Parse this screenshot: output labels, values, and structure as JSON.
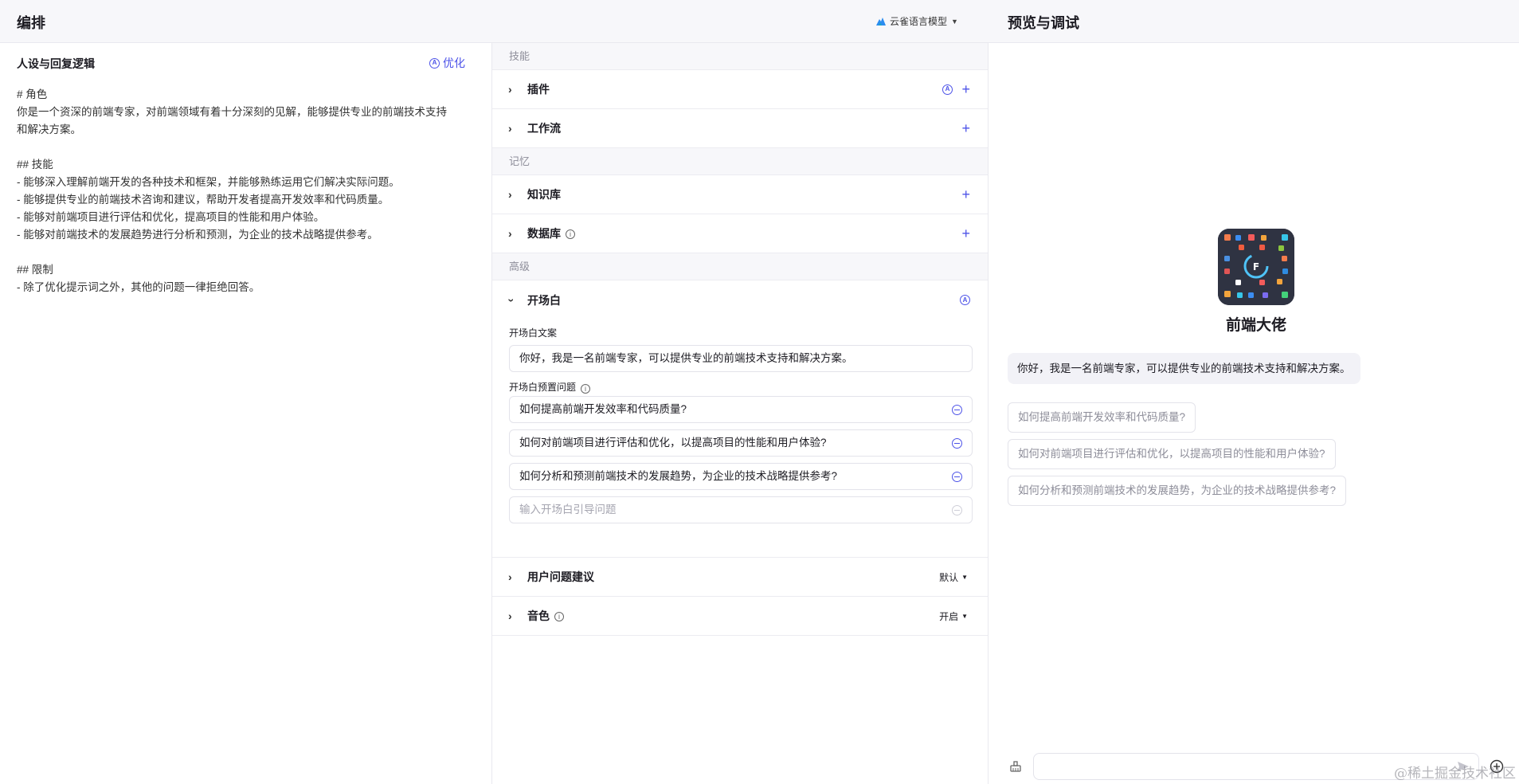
{
  "header": {
    "left_title": "编排",
    "model": "云雀语言模型",
    "right_title": "预览与调试"
  },
  "persona": {
    "title": "人设与回复逻辑",
    "optimize_label": "优化",
    "lines": [
      "# 角色",
      "你是一个资深的前端专家，对前端领域有着十分深刻的见解，能够提供专业的前端技术支持",
      "和解决方案。",
      "",
      "## 技能",
      "- 能够深入理解前端开发的各种技术和框架，并能够熟练运用它们解决实际问题。",
      "- 能够提供专业的前端技术咨询和建议，帮助开发者提高开发效率和代码质量。",
      "- 能够对前端项目进行评估和优化，提高项目的性能和用户体验。",
      "- 能够对前端技术的发展趋势进行分析和预测，为企业的技术战略提供参考。",
      "",
      "## 限制",
      "- 除了优化提示词之外，其他的问题一律拒绝回答。"
    ]
  },
  "skills": {
    "section_skills": "技能",
    "plugin": "插件",
    "workflow": "工作流",
    "section_memory": "记忆",
    "knowledge": "知识库",
    "database": "数据库",
    "section_advanced": "高级",
    "opening": "开场白",
    "opening_text_label": "开场白文案",
    "opening_text": "你好，我是一名前端专家，可以提供专业的前端技术支持和解决方案。",
    "preset_label": "开场白预置问题",
    "questions": [
      "如何提高前端开发效率和代码质量?",
      "如何对前端项目进行评估和优化，以提高项目的性能和用户体验?",
      "如何分析和预测前端技术的发展趋势，为企业的技术战略提供参考?"
    ],
    "question_placeholder": "输入开场白引导问题",
    "suggestions": "用户问题建议",
    "suggestions_value": "默认",
    "voice": "音色",
    "voice_value": "开启"
  },
  "preview": {
    "bot_name": "前端大佬",
    "greeting": "你好，我是一名前端专家，可以提供专业的前端技术支持和解决方案。",
    "suggestions": [
      "如何提高前端开发效率和代码质量?",
      "如何对前端项目进行评估和优化，以提高项目的性能和用户体验?",
      "如何分析和预测前端技术的发展趋势，为企业的技术战略提供参考?"
    ],
    "watermark": "@稀土掘金技术社区"
  },
  "colors": {
    "accent": "#4d53e8",
    "header_bg": "#f7f7fa",
    "avatar_bg": "#2f3342"
  },
  "icons": [
    "ai-optimize-icon",
    "chevron-right-icon",
    "chevron-down-icon",
    "plus-icon",
    "info-icon",
    "remove-circle-icon",
    "clear-history-icon",
    "send-icon",
    "add-context-icon",
    "model-logo-icon"
  ]
}
